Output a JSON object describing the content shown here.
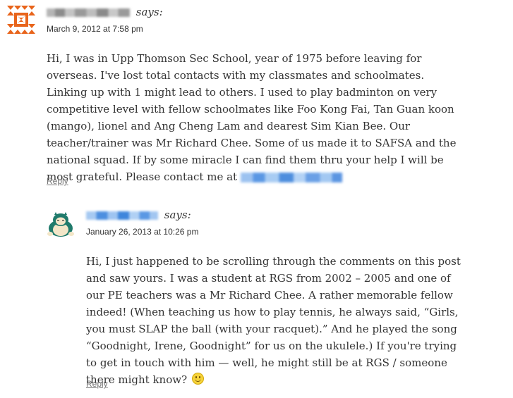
{
  "comment1": {
    "says": "says:",
    "date": "March 9, 2012 at 7:58 pm",
    "body": "Hi, I was in Upp Thomson Sec School, year of 1975 before leaving for overseas. I've lost total contacts with my classmates and schoolmates. Linking up with 1 might lead to others. I used to play badminton on very competitive level with fellow schoolmates like Foo Kong Fai, Tan Guan koon (mango), lionel and Ang Cheng Lam and dearest Sim Kian Bee. Our teacher/trainer was Mr Richard Chee. Some of us made it to SAFSA and the national squad. If by some miracle I can find them thru your help I will be most grateful. Please contact me at",
    "reply": "Reply",
    "avatar_icon": "geometric-pattern-avatar-icon"
  },
  "comment2": {
    "says": "says:",
    "date": "January 26, 2013 at 10:26 pm",
    "body": "Hi, I just happened to be scrolling through the comments on this post and saw yours. I was a student at RGS from 2002 – 2005 and one of our PE teachers was a Mr Richard Chee. A rather memorable fellow indeed! (When teaching us how to play tennis, he always said, “Girls, you must SLAP the ball (with your racquet).” And he played the song “Goodnight, Irene, Goodnight” for us on the ukulele.) If you're trying to get in touch with him — well, he might still be at RGS / someone there might know?",
    "reply": "Reply",
    "avatar_icon": "snorlax-avatar-icon"
  },
  "colors": {
    "avatar_orange": "#e8641b",
    "blur_gray": "#9a9a9a",
    "blur_blue": "#4a8fe0",
    "reply_gray": "#777777"
  }
}
